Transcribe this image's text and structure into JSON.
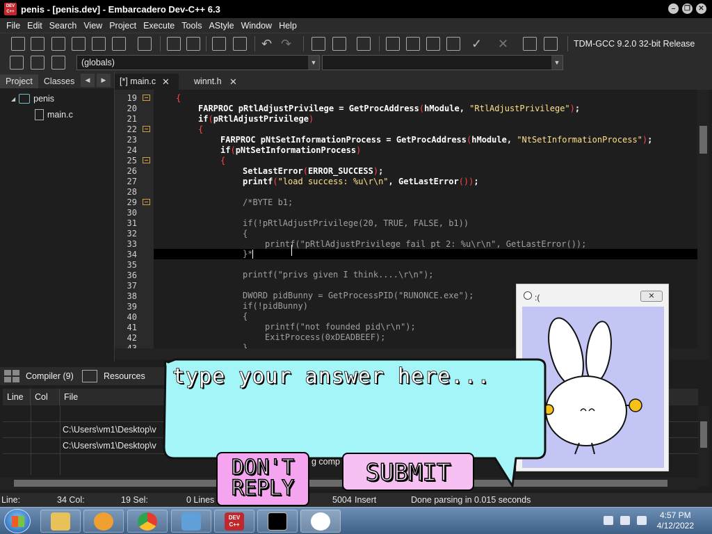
{
  "window": {
    "title": "penis - [penis.dev] - Embarcadero Dev-C++ 6.3",
    "icon_text": "DEV C++"
  },
  "menu": [
    "File",
    "Edit",
    "Search",
    "View",
    "Project",
    "Execute",
    "Tools",
    "AStyle",
    "Window",
    "Help"
  ],
  "toolbar": {
    "compiler": "TDM-GCC 9.2.0 32-bit Release",
    "scope": "(globals)"
  },
  "left_panel": {
    "tabs": [
      "Project",
      "Classes"
    ],
    "tree": {
      "project": "penis",
      "file": "main.c"
    }
  },
  "editor_tabs": [
    {
      "label": "[*] main.c"
    },
    {
      "label": "winnt.h"
    }
  ],
  "editor": {
    "lines": [
      {
        "n": "19",
        "fold": true
      },
      {
        "n": "20",
        "fold": false
      },
      {
        "n": "21",
        "fold": false
      },
      {
        "n": "22",
        "fold": true
      },
      {
        "n": "23",
        "fold": false
      },
      {
        "n": "24",
        "fold": false
      },
      {
        "n": "25",
        "fold": true
      },
      {
        "n": "26",
        "fold": false
      },
      {
        "n": "27",
        "fold": false
      },
      {
        "n": "28",
        "fold": false
      },
      {
        "n": "29",
        "fold": true
      },
      {
        "n": "30",
        "fold": false
      },
      {
        "n": "31",
        "fold": false
      },
      {
        "n": "32",
        "fold": false
      },
      {
        "n": "33",
        "fold": false
      },
      {
        "n": "34",
        "fold": false
      },
      {
        "n": "35",
        "fold": false
      },
      {
        "n": "36",
        "fold": false
      },
      {
        "n": "37",
        "fold": false
      },
      {
        "n": "38",
        "fold": false
      },
      {
        "n": "39",
        "fold": false
      },
      {
        "n": "40",
        "fold": false
      },
      {
        "n": "41",
        "fold": false
      },
      {
        "n": "42",
        "fold": false
      },
      {
        "n": "43",
        "fold": false
      }
    ],
    "code": {
      "l19": "{",
      "l20_a": "FARPROC pRtlAdjustPrivilege = GetProcAddress",
      "l20_b": "hModule, ",
      "l20_s": "\"RtlAdjustPrivilege\"",
      "l21_a": "if",
      "l21_b": "pRtlAdjustPrivilege",
      "l22": "{",
      "l23_a": "FARPROC pNtSetInformationProcess = GetProcAddress",
      "l23_b": "hModule, ",
      "l23_s": "\"NtSetInformationProcess\"",
      "l24_a": "if",
      "l24_b": "pNtSetInformationProcess",
      "l25": "{",
      "l26_a": "SetLastError",
      "l26_b": "ERROR_SUCCESS",
      "l27_a": "printf",
      "l27_s": "\"load success: %u\\r\\n\"",
      "l27_b": ", GetLastError",
      "l29": "/*BYTE b1;",
      "l31": "if(!pRtlAdjustPrivilege(20, TRUE, FALSE, b1))",
      "l32": "{",
      "l33": "printf(\"pRtlAdjustPrivilege fail pt 2: %u\\r\\n\", GetLastError());",
      "l34": "}*",
      "l36": "printf(\"privs given I think....\\r\\n\");",
      "l38": "DWORD pidBunny = GetProcessPID(\"RUNONCE.exe\");",
      "l39": "if(!pidBunny)",
      "l40": "{",
      "l41": "printf(\"not founded pid\\r\\n\");",
      "l42": "ExitProcess(0xDEADBEEF);",
      "l43": "}"
    }
  },
  "bottom": {
    "tabs": [
      "Compiler (9)",
      "Resources"
    ],
    "columns": [
      "Line",
      "Col",
      "File"
    ],
    "rows": [
      {
        "file": ""
      },
      {
        "file": "C:\\Users\\vm1\\Desktop\\v"
      },
      {
        "file": "C:\\Users\\vm1\\Desktop\\v"
      }
    ],
    "partial_message": "g comp"
  },
  "status": {
    "line": "Line:",
    "col": "34 Col:",
    "sel": "19 Sel:",
    "lines": "0 Lines",
    "length": "5004",
    "mode": "Insert",
    "message": "Done parsing in 0.015 seconds"
  },
  "taskbar": {
    "time": "4:57 PM",
    "date": "4/12/2022",
    "dev_icon_text": "DEV C++"
  },
  "popup": {
    "title": ":("
  },
  "bubble": {
    "placeholder": "type your answer here...",
    "dont_reply_line1": "DON'T",
    "dont_reply_line2": "REPLY",
    "submit": "SUBMIT"
  }
}
